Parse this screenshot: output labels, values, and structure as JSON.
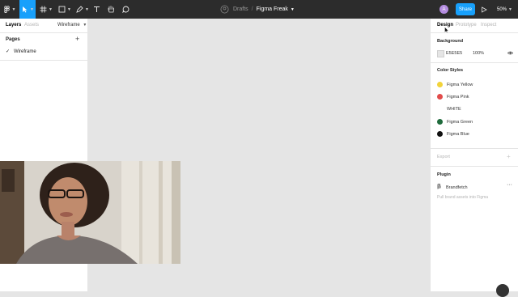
{
  "toolbar": {
    "breadcrumb": "Drafts",
    "separator": "/",
    "file_name": "Figma Freak",
    "share_label": "Share",
    "zoom_label": "50%",
    "avatar_initial": "A",
    "accent_color": "#18a0fb",
    "tools": [
      "main-menu",
      "move",
      "frame",
      "shape",
      "pen",
      "text",
      "hand",
      "comment"
    ]
  },
  "left_panel": {
    "tabs": [
      "Layers",
      "Assets"
    ],
    "page_selector": "Wireframe",
    "pages_header": "Pages",
    "pages": [
      {
        "name": "Wireframe",
        "selected": true
      }
    ]
  },
  "right_panel": {
    "tabs": [
      "Design",
      "Prototype",
      "Inspect"
    ],
    "active_tab": "Design",
    "background": {
      "title": "Background",
      "hex": "E5E5E5",
      "opacity": "100%"
    },
    "color_styles": {
      "title": "Color Styles",
      "items": [
        {
          "name": "Figma Yellow",
          "color": "#f2d33a"
        },
        {
          "name": "Figma Pink",
          "color": "#e24c4b"
        },
        {
          "name": "WHITE",
          "color": "#ffffff"
        },
        {
          "name": "Figma Green",
          "color": "#1f6b3c"
        },
        {
          "name": "Figma Blue",
          "color": "#111111"
        }
      ]
    },
    "export": {
      "title": "Export"
    },
    "plugin": {
      "title": "Plugin",
      "name": "Brandfetch",
      "description": "Pull brand assets into Figma"
    }
  }
}
